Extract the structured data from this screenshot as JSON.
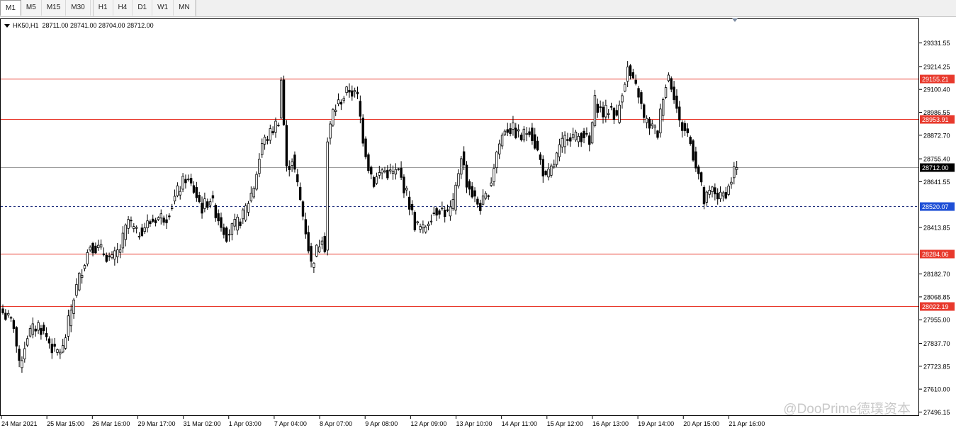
{
  "toolbar": {
    "timeframes": [
      "M1",
      "M5",
      "M15",
      "M30",
      "H1",
      "H4",
      "D1",
      "W1",
      "MN"
    ],
    "active": "M1"
  },
  "colors": {
    "background": "#ffffff",
    "candle": "#000000",
    "level_line": "#e8392c",
    "current_line": "#9a9a9a",
    "dashed_line": "#1a2a7a",
    "watermark": "#c9c9c9"
  },
  "chart_data": {
    "type": "candlestick",
    "symbol": "HK50,H1",
    "ohlc_header": {
      "open": "28711.00",
      "high": "28741.00",
      "low": "28704.00",
      "close": "28712.00"
    },
    "y_ticks": [
      "29331.55",
      "29214.25",
      "29100.40",
      "28986.55",
      "28872.70",
      "28755.40",
      "28641.55",
      "28413.85",
      "28182.70",
      "28068.85",
      "27955.00",
      "27837.70",
      "27723.85",
      "27610.00",
      "27496.15"
    ],
    "ylim": [
      27480,
      29450
    ],
    "x_ticks": [
      "24 Mar 2021",
      "25 Mar 15:00",
      "26 Mar 16:00",
      "29 Mar 17:00",
      "31 Mar 02:00",
      "1 Apr 03:00",
      "7 Apr 04:00",
      "8 Apr 07:00",
      "9 Apr 08:00",
      "12 Apr 09:00",
      "13 Apr 10:00",
      "14 Apr 11:00",
      "15 Apr 12:00",
      "16 Apr 13:00",
      "19 Apr 14:00",
      "20 Apr 15:00",
      "21 Apr 16:00"
    ],
    "levels": [
      {
        "value": 29155.21,
        "label": "29155.21",
        "style": "solid-red"
      },
      {
        "value": 28953.91,
        "label": "28953.91",
        "style": "solid-red"
      },
      {
        "value": 28712.0,
        "label": "28712.00",
        "style": "current-price"
      },
      {
        "value": 28520.07,
        "label": "28520.07",
        "style": "dashed-blue"
      },
      {
        "value": 28284.06,
        "label": "28284.06",
        "style": "solid-red"
      },
      {
        "value": 28022.19,
        "label": "28022.19",
        "style": "solid-red"
      }
    ],
    "anchors": [
      [
        0,
        27990
      ],
      [
        4,
        27930
      ],
      [
        6,
        27720
      ],
      [
        9,
        27880
      ],
      [
        13,
        27930
      ],
      [
        16,
        27870
      ],
      [
        19,
        27790
      ],
      [
        22,
        27810
      ],
      [
        26,
        28070
      ],
      [
        29,
        28210
      ],
      [
        32,
        28330
      ],
      [
        36,
        28300
      ],
      [
        40,
        28250
      ],
      [
        43,
        28310
      ],
      [
        46,
        28450
      ],
      [
        49,
        28380
      ],
      [
        52,
        28420
      ],
      [
        56,
        28460
      ],
      [
        60,
        28470
      ],
      [
        64,
        28590
      ],
      [
        67,
        28660
      ],
      [
        70,
        28600
      ],
      [
        73,
        28510
      ],
      [
        76,
        28560
      ],
      [
        79,
        28460
      ],
      [
        82,
        28380
      ],
      [
        85,
        28420
      ],
      [
        88,
        28470
      ],
      [
        92,
        28620
      ],
      [
        95,
        28830
      ],
      [
        98,
        28880
      ],
      [
        101,
        28950
      ],
      [
        102,
        29150
      ],
      [
        104,
        28700
      ],
      [
        106,
        28760
      ],
      [
        108,
        28620
      ],
      [
        111,
        28400
      ],
      [
        113,
        28230
      ],
      [
        115,
        28300
      ],
      [
        117,
        28380
      ],
      [
        118,
        28320
      ],
      [
        119,
        28840
      ],
      [
        121,
        28990
      ],
      [
        124,
        29050
      ],
      [
        127,
        29100
      ],
      [
        130,
        29060
      ],
      [
        132,
        28860
      ],
      [
        134,
        28720
      ],
      [
        136,
        28640
      ],
      [
        139,
        28700
      ],
      [
        142,
        28680
      ],
      [
        145,
        28690
      ],
      [
        148,
        28580
      ],
      [
        151,
        28430
      ],
      [
        154,
        28400
      ],
      [
        157,
        28480
      ],
      [
        160,
        28510
      ],
      [
        163,
        28480
      ],
      [
        165,
        28520
      ],
      [
        168,
        28780
      ],
      [
        170,
        28640
      ],
      [
        173,
        28550
      ],
      [
        175,
        28520
      ],
      [
        177,
        28560
      ],
      [
        179,
        28650
      ],
      [
        181,
        28790
      ],
      [
        184,
        28910
      ],
      [
        187,
        28900
      ],
      [
        190,
        28860
      ],
      [
        193,
        28910
      ],
      [
        196,
        28790
      ],
      [
        199,
        28650
      ],
      [
        201,
        28700
      ],
      [
        204,
        28800
      ],
      [
        207,
        28880
      ],
      [
        210,
        28860
      ],
      [
        213,
        28880
      ],
      [
        215,
        28820
      ],
      [
        217,
        29040
      ],
      [
        220,
        28980
      ],
      [
        223,
        29010
      ],
      [
        225,
        28950
      ],
      [
        227,
        29100
      ],
      [
        229,
        29200
      ],
      [
        231,
        29130
      ],
      [
        233,
        29080
      ],
      [
        235,
        28950
      ],
      [
        238,
        28910
      ],
      [
        240,
        28880
      ],
      [
        242,
        29080
      ],
      [
        244,
        29170
      ],
      [
        246,
        29080
      ],
      [
        248,
        28930
      ],
      [
        251,
        28880
      ],
      [
        253,
        28780
      ],
      [
        255,
        28680
      ],
      [
        257,
        28540
      ],
      [
        260,
        28600
      ],
      [
        263,
        28560
      ],
      [
        266,
        28610
      ],
      [
        268,
        28700
      ],
      [
        269,
        28712
      ]
    ]
  },
  "watermark": " @DooPrime德璞资本"
}
